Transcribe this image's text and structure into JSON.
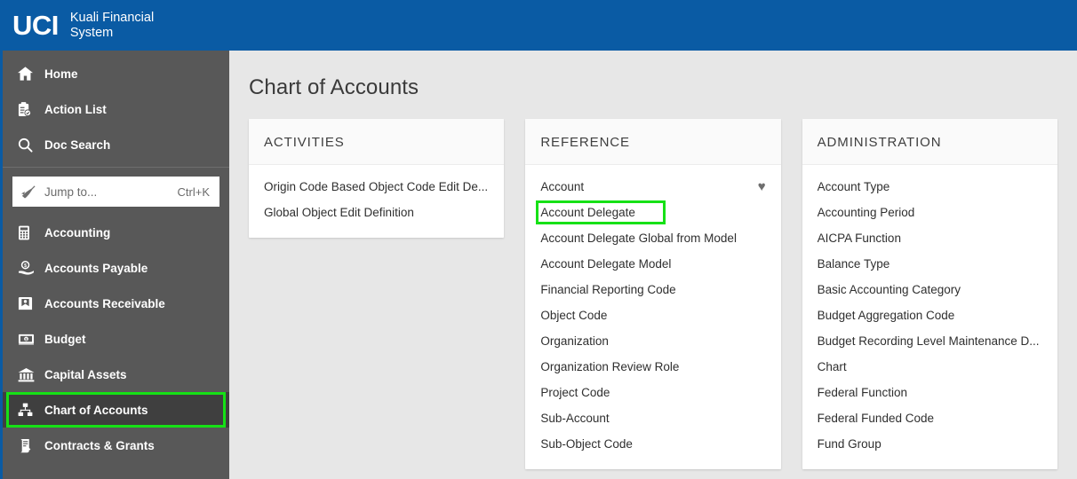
{
  "header": {
    "logo_text": "UCI",
    "product_name": "Kuali Financial\nSystem",
    "brand_color": "#0a5ba4"
  },
  "sidebar": {
    "background_color": "#585858",
    "selected_color": "#3f3f3f",
    "highlight_color": "#16e116",
    "top_items": [
      {
        "label": "Home",
        "icon": "home-icon"
      },
      {
        "label": "Action List",
        "icon": "clipboard-check-icon"
      },
      {
        "label": "Doc Search",
        "icon": "search-icon"
      }
    ],
    "jump_to": {
      "placeholder": "Jump to...",
      "value": "",
      "shortcut": "Ctrl+K",
      "icon": "jump-to-icon"
    },
    "modules": [
      {
        "label": "Accounting",
        "icon": "calculator-icon",
        "selected": false
      },
      {
        "label": "Accounts Payable",
        "icon": "hand-coin-icon",
        "selected": false
      },
      {
        "label": "Accounts Receivable",
        "icon": "envelope-person-icon",
        "selected": false
      },
      {
        "label": "Budget",
        "icon": "money-icon",
        "selected": false
      },
      {
        "label": "Capital Assets",
        "icon": "bank-icon",
        "selected": false
      },
      {
        "label": "Chart of Accounts",
        "icon": "org-chart-icon",
        "selected": true
      },
      {
        "label": "Contracts & Grants",
        "icon": "scroll-icon",
        "selected": false
      }
    ]
  },
  "main": {
    "page_title": "Chart of Accounts",
    "cards": [
      {
        "title": "ACTIVITIES",
        "links": [
          {
            "label": "Origin Code Based Object Code Edit De...",
            "favorite": false,
            "highlighted": false
          },
          {
            "label": "Global Object Edit Definition",
            "favorite": false,
            "highlighted": false
          }
        ]
      },
      {
        "title": "REFERENCE",
        "links": [
          {
            "label": "Account",
            "favorite": true,
            "highlighted": false
          },
          {
            "label": "Account Delegate",
            "favorite": false,
            "highlighted": true
          },
          {
            "label": "Account Delegate Global from Model",
            "favorite": false,
            "highlighted": false
          },
          {
            "label": "Account Delegate Model",
            "favorite": false,
            "highlighted": false
          },
          {
            "label": "Financial Reporting Code",
            "favorite": false,
            "highlighted": false
          },
          {
            "label": "Object Code",
            "favorite": false,
            "highlighted": false
          },
          {
            "label": "Organization",
            "favorite": false,
            "highlighted": false
          },
          {
            "label": "Organization Review Role",
            "favorite": false,
            "highlighted": false
          },
          {
            "label": "Project Code",
            "favorite": false,
            "highlighted": false
          },
          {
            "label": "Sub-Account",
            "favorite": false,
            "highlighted": false
          },
          {
            "label": "Sub-Object Code",
            "favorite": false,
            "highlighted": false
          }
        ]
      },
      {
        "title": "ADMINISTRATION",
        "links": [
          {
            "label": "Account Type",
            "favorite": false,
            "highlighted": false
          },
          {
            "label": "Accounting Period",
            "favorite": false,
            "highlighted": false
          },
          {
            "label": "AICPA Function",
            "favorite": false,
            "highlighted": false
          },
          {
            "label": "Balance Type",
            "favorite": false,
            "highlighted": false
          },
          {
            "label": "Basic Accounting Category",
            "favorite": false,
            "highlighted": false
          },
          {
            "label": "Budget Aggregation Code",
            "favorite": false,
            "highlighted": false
          },
          {
            "label": "Budget Recording Level Maintenance D...",
            "favorite": false,
            "highlighted": false
          },
          {
            "label": "Chart",
            "favorite": false,
            "highlighted": false
          },
          {
            "label": "Federal Function",
            "favorite": false,
            "highlighted": false
          },
          {
            "label": "Federal Funded Code",
            "favorite": false,
            "highlighted": false
          },
          {
            "label": "Fund Group",
            "favorite": false,
            "highlighted": false
          }
        ]
      }
    ],
    "favorite_glyph": "♥"
  }
}
